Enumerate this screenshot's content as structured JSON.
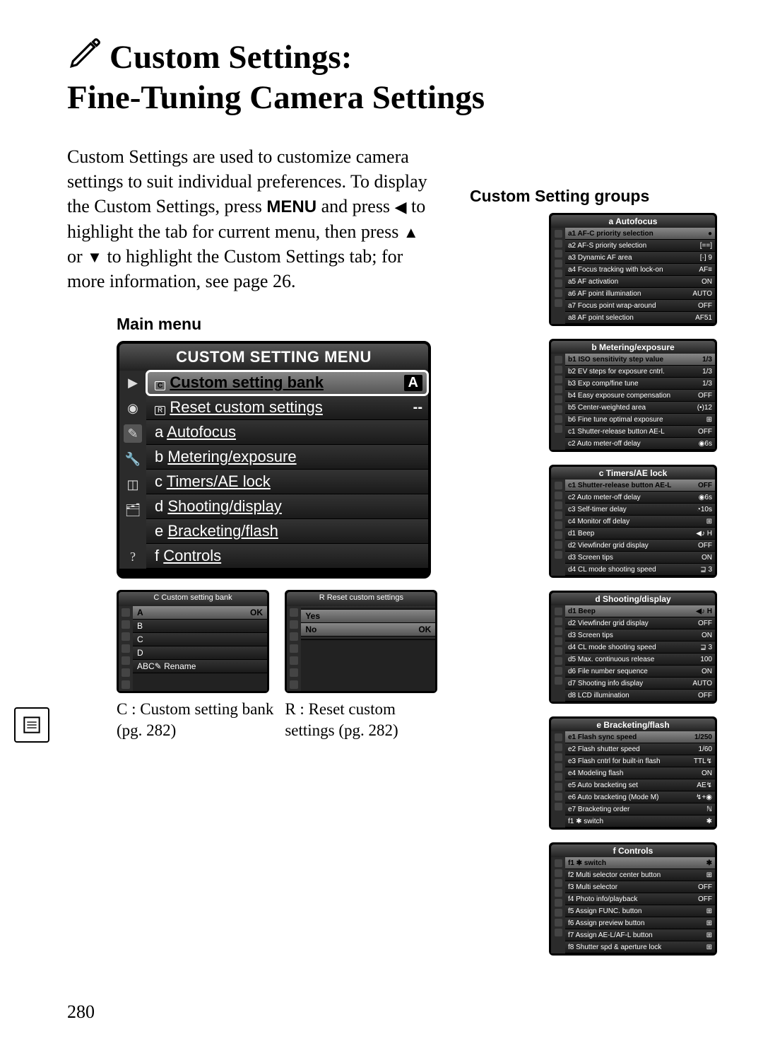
{
  "page_number": "280",
  "title_line1": "Custom Settings:",
  "title_line2": "Fine-Tuning Camera Settings",
  "body_part1": "Custom Settings are used to customize camera settings to suit individual preferences.  To display the Custom Settings, press ",
  "body_menu": "MENU",
  "body_part2": " and press ",
  "body_part3": " to highlight the tab for current menu, then press ",
  "body_part4": " or ",
  "body_part5": " to highlight the Custom Settings tab; for more information, see page 26.",
  "main_menu_label": "Main menu",
  "main_menu": {
    "header": "CUSTOM SETTING MENU",
    "rows": [
      {
        "label": "Custom setting bank",
        "prefix": "C",
        "val": "A",
        "sel": true,
        "bank": true
      },
      {
        "label": "Reset custom settings",
        "prefix": "R",
        "val": "--"
      },
      {
        "label": "Autofocus",
        "prefix": "a",
        "val": ""
      },
      {
        "label": "Metering/exposure",
        "prefix": "b",
        "val": ""
      },
      {
        "label": "Timers/AE lock",
        "prefix": "c",
        "val": ""
      },
      {
        "label": "Shooting/display",
        "prefix": "d",
        "val": ""
      },
      {
        "label": "Bracketing/flash",
        "prefix": "e",
        "val": ""
      },
      {
        "label": "Controls",
        "prefix": "f",
        "val": ""
      }
    ]
  },
  "thumb_left": {
    "header": "C Custom setting bank",
    "rows": [
      {
        "label": "A",
        "val": "OK",
        "sel": true
      },
      {
        "label": "B",
        "val": ""
      },
      {
        "label": "C",
        "val": ""
      },
      {
        "label": "D",
        "val": ""
      },
      {
        "label": "ABC✎ Rename",
        "val": ""
      }
    ],
    "caption": "C : Custom setting bank (pg. 282)"
  },
  "thumb_right": {
    "header": "R Reset custom settings",
    "rows": [
      {
        "label": "",
        "val": ""
      },
      {
        "label": "Yes",
        "val": "",
        "mid": true
      },
      {
        "label": "No",
        "val": "OK",
        "sel": true
      },
      {
        "label": "",
        "val": ""
      }
    ],
    "caption": "R : Reset custom settings (pg. 282)"
  },
  "groups_label": "Custom Setting groups",
  "groups": [
    {
      "header": "a  Autofocus",
      "rows": [
        {
          "n": "a1",
          "label": "AF-C priority selection",
          "v": "●",
          "sel": true
        },
        {
          "n": "a2",
          "label": "AF-S priority selection",
          "v": "[==]"
        },
        {
          "n": "a3",
          "label": "Dynamic AF area",
          "v": "[·] 9"
        },
        {
          "n": "a4",
          "label": "Focus tracking with lock-on",
          "v": "AF≡"
        },
        {
          "n": "a5",
          "label": "AF activation",
          "v": "ON"
        },
        {
          "n": "a6",
          "label": "AF point illumination",
          "v": "AUTO"
        },
        {
          "n": "a7",
          "label": "Focus point wrap-around",
          "v": "OFF"
        },
        {
          "n": "a8",
          "label": "AF point selection",
          "v": "AF51"
        }
      ]
    },
    {
      "header": "b  Metering/exposure",
      "rows": [
        {
          "n": "b1",
          "label": "ISO sensitivity step value",
          "v": "1/3",
          "sel": true
        },
        {
          "n": "b2",
          "label": "EV steps for exposure cntrl.",
          "v": "1/3"
        },
        {
          "n": "b3",
          "label": "Exp comp/fine tune",
          "v": "1/3"
        },
        {
          "n": "b4",
          "label": "Easy exposure compensation",
          "v": "OFF"
        },
        {
          "n": "b5",
          "label": "Center-weighted area",
          "v": "(•)12"
        },
        {
          "n": "b6",
          "label": "Fine tune optimal exposure",
          "v": "⊞"
        },
        {
          "n": "c1",
          "label": "Shutter-release button AE-L",
          "v": "OFF"
        },
        {
          "n": "c2",
          "label": "Auto meter-off delay",
          "v": "◉6s"
        }
      ]
    },
    {
      "header": "c  Timers/AE lock",
      "rows": [
        {
          "n": "c1",
          "label": "Shutter-release button AE-L",
          "v": "OFF",
          "sel": true
        },
        {
          "n": "c2",
          "label": "Auto meter-off delay",
          "v": "◉6s"
        },
        {
          "n": "c3",
          "label": "Self-timer delay",
          "v": "◔10s"
        },
        {
          "n": "c4",
          "label": "Monitor off delay",
          "v": "⊞"
        },
        {
          "n": "d1",
          "label": "Beep",
          "v": "◀♪ H"
        },
        {
          "n": "d2",
          "label": "Viewfinder grid display",
          "v": "OFF"
        },
        {
          "n": "d3",
          "label": "Screen tips",
          "v": "ON"
        },
        {
          "n": "d4",
          "label": "CL mode shooting speed",
          "v": "⊒ 3"
        }
      ]
    },
    {
      "header": "d  Shooting/display",
      "rows": [
        {
          "n": "d1",
          "label": "Beep",
          "v": "◀♪ H",
          "sel": true
        },
        {
          "n": "d2",
          "label": "Viewfinder grid display",
          "v": "OFF"
        },
        {
          "n": "d3",
          "label": "Screen tips",
          "v": "ON"
        },
        {
          "n": "d4",
          "label": "CL mode shooting speed",
          "v": "⊒ 3"
        },
        {
          "n": "d5",
          "label": "Max. continuous release",
          "v": "100"
        },
        {
          "n": "d6",
          "label": "File number sequence",
          "v": "ON"
        },
        {
          "n": "d7",
          "label": "Shooting info display",
          "v": "AUTO"
        },
        {
          "n": "d8",
          "label": "LCD illumination",
          "v": "OFF"
        }
      ]
    },
    {
      "header": "e  Bracketing/flash",
      "rows": [
        {
          "n": "e1",
          "label": "Flash sync speed",
          "v": "1/250",
          "sel": true
        },
        {
          "n": "e2",
          "label": "Flash shutter speed",
          "v": "1/60"
        },
        {
          "n": "e3",
          "label": "Flash cntrl for built-in flash",
          "v": "TTL↯"
        },
        {
          "n": "e4",
          "label": "Modeling flash",
          "v": "ON"
        },
        {
          "n": "e5",
          "label": "Auto bracketing set",
          "v": "AE↯"
        },
        {
          "n": "e6",
          "label": "Auto bracketing (Mode M)",
          "v": "↯+◉"
        },
        {
          "n": "e7",
          "label": "Bracketing order",
          "v": "ℕ"
        },
        {
          "n": "f1",
          "label": "✱ switch",
          "v": "✱"
        }
      ]
    },
    {
      "header": "f  Controls",
      "rows": [
        {
          "n": "f1",
          "label": "✱ switch",
          "v": "✱",
          "sel": true
        },
        {
          "n": "f2",
          "label": "Multi selector center button",
          "v": "⊞"
        },
        {
          "n": "f3",
          "label": "Multi selector",
          "v": "OFF"
        },
        {
          "n": "f4",
          "label": "Photo info/playback",
          "v": "OFF"
        },
        {
          "n": "f5",
          "label": "Assign FUNC. button",
          "v": "⊞"
        },
        {
          "n": "f6",
          "label": "Assign preview button",
          "v": "⊞"
        },
        {
          "n": "f7",
          "label": "Assign AE-L/AF-L button",
          "v": "⊞"
        },
        {
          "n": "f8",
          "label": "Shutter spd & aperture lock",
          "v": "⊞"
        }
      ]
    }
  ]
}
